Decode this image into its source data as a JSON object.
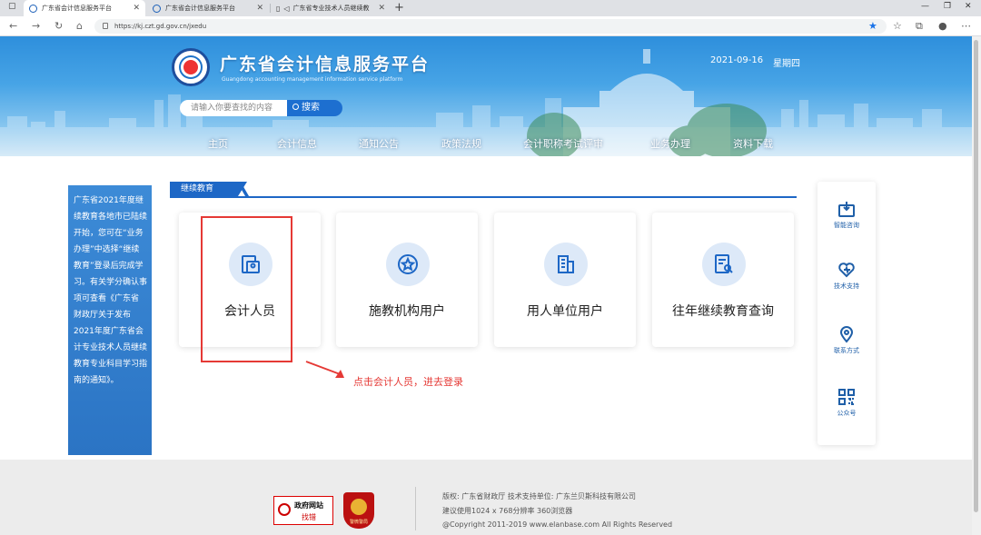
{
  "browser": {
    "tabs": [
      {
        "title": "广东省会计信息服务平台",
        "active": true
      },
      {
        "title": "广东省会计信息服务平台",
        "active": false
      },
      {
        "title": "广东省专业技术人员继续教",
        "active": false
      }
    ],
    "new_tab": "+",
    "url": "https://kj.czt.gd.gov.cn/jxedu"
  },
  "header": {
    "title": "广东省会计信息服务平台",
    "subtitle": "Guangdong accounting management information service platform",
    "date": "2021-09-16",
    "weekday": "星期四",
    "search": {
      "placeholder": "请输入你要查找的内容",
      "button": "搜索"
    },
    "nav": [
      "主页",
      "会计信息",
      "通知公告",
      "政策法规",
      "会计职称考试评审",
      "业务办理",
      "资料下载"
    ]
  },
  "notice": {
    "lines": [
      "广东省2021年度继",
      "续教育各地市已陆续",
      "开始，您可在“业务",
      "办理”中选择“继续",
      "教育”登录后完成学",
      "习。有关学分确认事",
      "项可查看《广东省",
      "财政厅关于发布",
      "2021年度广东省会",
      "计专业技术人员继续",
      "教育专业科目学习指",
      "南的通知》。"
    ]
  },
  "section": {
    "title": "继续教育"
  },
  "cards": [
    {
      "label": "会计人员",
      "icon": "accountant-icon"
    },
    {
      "label": "施教机构用户",
      "icon": "institution-icon"
    },
    {
      "label": "用人单位用户",
      "icon": "building-icon"
    },
    {
      "label": "往年继续教育查询",
      "icon": "query-document-icon"
    }
  ],
  "annotation": {
    "hint": "点击会计人员，进去登录",
    "color": "#e53935"
  },
  "side": [
    {
      "label": "智能咨询",
      "icon": "smart-consult-icon"
    },
    {
      "label": "技术支持",
      "icon": "tech-support-icon"
    },
    {
      "label": "联系方式",
      "icon": "location-pin-icon"
    },
    {
      "label": "公众号",
      "icon": "qr-code-icon"
    }
  ],
  "footer": {
    "gov_badge": {
      "line1": "政府网站",
      "line2": "找错"
    },
    "police_badge": "警微警局",
    "lines": [
      "版权: 广东省财政厅 技术支持单位: 广东兰贝斯科技有限公司",
      "建议使用1024 x 768分辨率 360浏览器",
      "@Copyright 2011-2019 www.elanbase.com All Rights Reserved"
    ]
  },
  "colors": {
    "accent": "#1d67c6",
    "banner_top": "#2e8fdc",
    "icon_bg": "#dde9f8",
    "annotation": "#e53935"
  }
}
